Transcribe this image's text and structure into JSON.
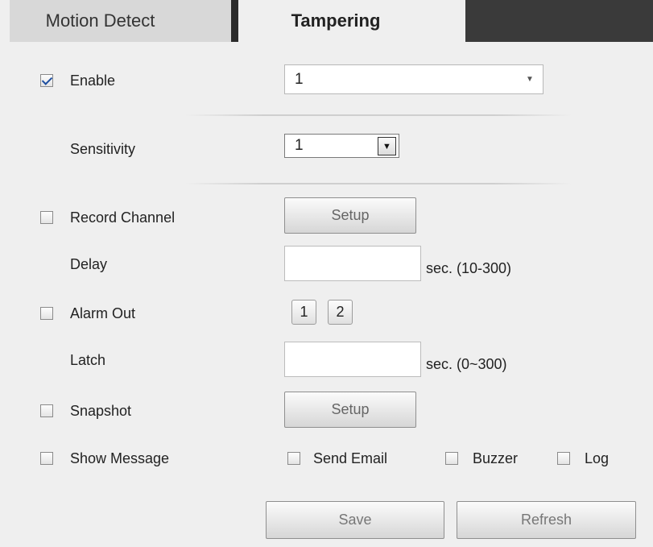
{
  "tabs": {
    "motion": "Motion Detect",
    "tampering": "Tampering"
  },
  "enable": {
    "label": "Enable",
    "checked": true,
    "value": "1"
  },
  "sensitivity": {
    "label": "Sensitivity",
    "value": "1"
  },
  "record_channel": {
    "label": "Record Channel",
    "checked": false,
    "button": "Setup"
  },
  "delay": {
    "label": "Delay",
    "value": "",
    "unit": "sec.  (10-300)"
  },
  "alarm_out": {
    "label": "Alarm Out",
    "checked": false,
    "outputs": [
      "1",
      "2"
    ]
  },
  "latch": {
    "label": "Latch",
    "value": "",
    "unit": "sec.  (0~300)"
  },
  "snapshot": {
    "label": "Snapshot",
    "checked": false,
    "button": "Setup"
  },
  "show_message": {
    "label": "Show Message",
    "checked": false
  },
  "send_email": {
    "label": "Send Email",
    "checked": false
  },
  "buzzer": {
    "label": "Buzzer",
    "checked": false
  },
  "log": {
    "label": "Log",
    "checked": false
  },
  "actions": {
    "save": "Save",
    "refresh": "Refresh"
  }
}
